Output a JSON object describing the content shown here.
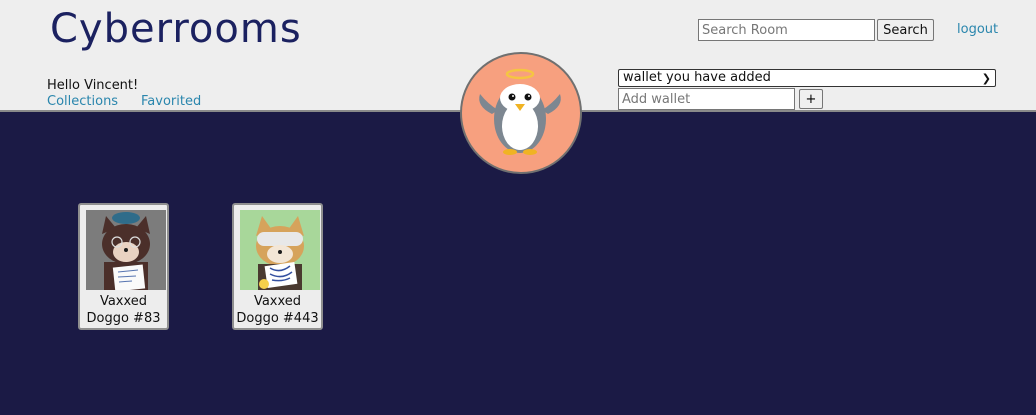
{
  "header": {
    "logo": "Cyberrooms",
    "greeting": "Hello Vincent!",
    "nav": {
      "collections": "Collections",
      "favorited": "Favorited"
    },
    "search": {
      "placeholder": "Search Room",
      "button": "Search"
    },
    "logout": "logout",
    "wallet": {
      "selected": "wallet you have added",
      "placeholder": "Add wallet",
      "add_button": "+"
    }
  },
  "colors": {
    "background": "#1b1a45",
    "header_bg": "#eeeeee",
    "link": "#2a86ad",
    "logo": "#1b2160",
    "avatar_bg": "#f7a07f"
  },
  "collections": [
    {
      "line1": "Vaxxed",
      "line2": "Doggo #83",
      "thumb_bg": "#7c7c7c",
      "icon": "shiba-dog-nft-image"
    },
    {
      "line1": "Vaxxed",
      "line2": "Doggo #443",
      "thumb_bg": "#a8d79a",
      "icon": "shiba-dog-nft-image"
    }
  ]
}
